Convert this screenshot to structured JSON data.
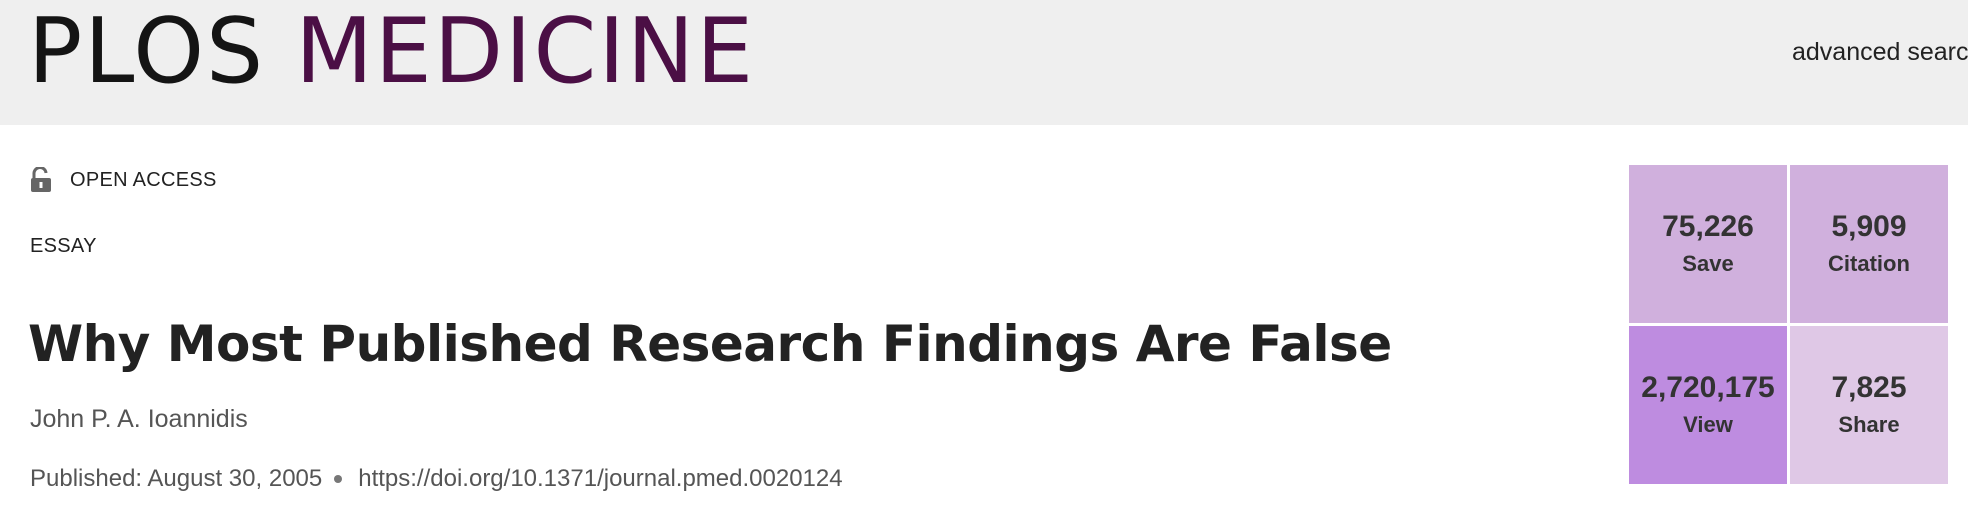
{
  "header": {
    "logo_part1": "PLOS",
    "logo_part2": "MEDICINE",
    "advanced_search": "advanced searc",
    "colors": {
      "background": "#efefef",
      "logo_dark": "#141414",
      "logo_purple": "#4b0f45"
    }
  },
  "article": {
    "access_icon": "unlocked-padlock-icon",
    "access_label": "OPEN ACCESS",
    "type": "ESSAY",
    "title": "Why Most Published Research Findings Are False",
    "authors": "John P. A. Ioannidis",
    "published": "Published: August 30, 2005",
    "doi": "https://doi.org/10.1371/journal.pmed.0020124"
  },
  "metrics": {
    "save": {
      "value": "75,226",
      "label": "Save",
      "color": "#d0b0dd"
    },
    "citation": {
      "value": "5,909",
      "label": "Citation",
      "color": "#d0b0dd"
    },
    "view": {
      "value": "2,720,175",
      "label": "View",
      "color": "#be8ce0"
    },
    "share": {
      "value": "7,825",
      "label": "Share",
      "color": "#dfc8e6"
    }
  }
}
